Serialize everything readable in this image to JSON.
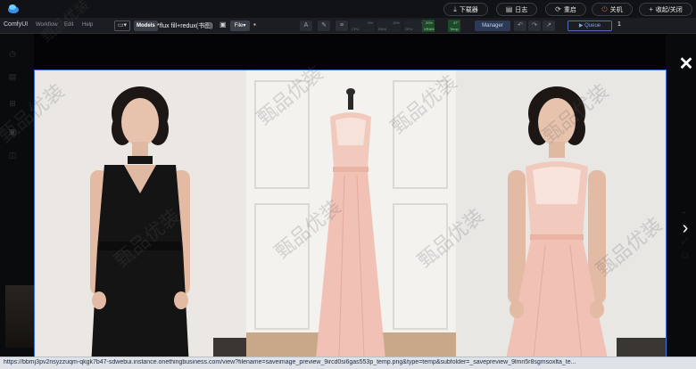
{
  "topbar": {
    "buttons": [
      {
        "label": "下载器",
        "icon": "download-icon"
      },
      {
        "label": "日志",
        "icon": "log-icon"
      },
      {
        "label": "重启",
        "icon": "restart-icon"
      },
      {
        "label": "关机",
        "icon": "power-icon"
      },
      {
        "label": "收起/关闭",
        "icon": "plus-icon"
      }
    ]
  },
  "menubar": {
    "brand": "ComfyUI",
    "items": [
      "Workflow",
      "Edit",
      "Help"
    ],
    "models_label": "Models",
    "workflow_title": "*flux fill+redux(书图)",
    "file_label": "File",
    "manager_label": "Manager",
    "queue_label": "Queue",
    "queue_count": "1",
    "meters": [
      {
        "label": "CPU",
        "value": "9%"
      },
      {
        "label": "RAM",
        "value": "15%"
      },
      {
        "label": "GPU",
        "value": "0%"
      },
      {
        "label": "VRAM",
        "value": "20%"
      },
      {
        "label": "Temp",
        "value": "37°"
      }
    ]
  },
  "preview": {
    "images": [
      {
        "description_icon": "model-black-jumpsuit-image"
      },
      {
        "description_icon": "pink-dress-on-mannequin-image"
      },
      {
        "description_icon": "model-pink-dress-image"
      }
    ]
  },
  "watermark": "甄品优装",
  "status": {
    "url": "https://bbmj3pv2nsyzzuqm-qkgk7b47-sdwebui.instance.onethingbusiness.com/view?filename=saveimage_preview_9ircd0si6gas553p_temp.png&type=temp&subfolder=_savepreview_9lmn5r8sgmsoxlta_te..."
  },
  "colors": {
    "accent": "#3f6fd8",
    "power": "#e04a4a",
    "dress_pink": "#f0c1b4",
    "jumpsuit": "#141414"
  }
}
